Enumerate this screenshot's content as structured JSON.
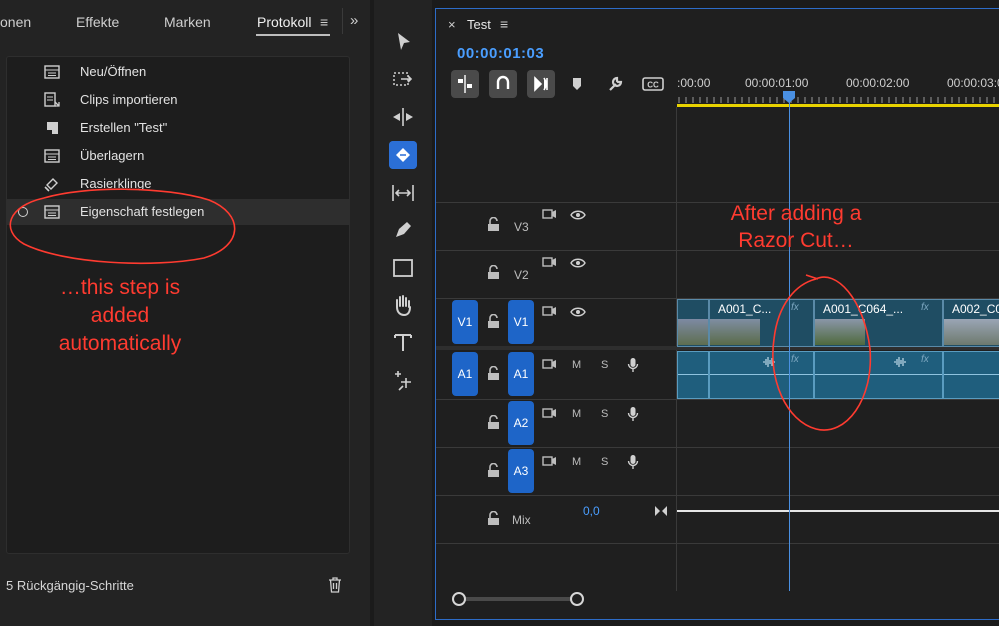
{
  "left_panel": {
    "tabs": [
      "onen",
      "Effekte",
      "Marken",
      "Protokoll"
    ],
    "active_tab": "Protokoll",
    "menu_icon": "hamburger-icon",
    "overflow_icon": "double-chevron-right-icon",
    "history": [
      {
        "label": "Neu/Öffnen",
        "icon": "sequence-icon"
      },
      {
        "label": "Clips importieren",
        "icon": "import-icon"
      },
      {
        "label": "Erstellen \"Test\"",
        "icon": "create-icon"
      },
      {
        "label": "Überlagern",
        "icon": "sequence-icon"
      },
      {
        "label": "Rasierklinge",
        "icon": "razor-icon"
      },
      {
        "label": "Eigenschaft festlegen",
        "icon": "sequence-icon",
        "selected": true
      }
    ],
    "footer": "5 Rückgängig-Schritte",
    "trash_icon": "trash-icon"
  },
  "annotations": {
    "left_lines": [
      "…this step is",
      "added",
      "automatically"
    ],
    "right_lines": [
      "After adding a",
      "Razor Cut…"
    ],
    "color": "#ff3b30"
  },
  "toolbar": {
    "tools": [
      "selection-tool-icon",
      "track-select-forward-icon",
      "ripple-edit-icon",
      "razor-tool-icon",
      "slip-tool-icon",
      "pen-tool-icon",
      "rectangle-tool-icon",
      "hand-tool-icon",
      "type-tool-icon",
      "remix-tool-icon"
    ],
    "active_tool": "razor-tool-icon",
    "active_color": "#2b6fd6"
  },
  "timeline": {
    "tab_title": "Test",
    "timecode": "00:00:01:03",
    "ruler_labels": [
      ":00:00",
      "00:00:01:00",
      "00:00:02:00",
      "00:00:03:0"
    ],
    "tracks": [
      {
        "target": "",
        "name": "V3"
      },
      {
        "target": "",
        "name": "V2"
      },
      {
        "target": "V1",
        "name": "V1"
      },
      {
        "target": "A1",
        "name": "A1",
        "m": "M",
        "s": "S"
      },
      {
        "target": "",
        "name": "A2",
        "m": "M",
        "s": "S"
      },
      {
        "target": "",
        "name": "A3",
        "m": "M",
        "s": "S"
      }
    ],
    "mix": {
      "label": "Mix",
      "value": "0,0"
    },
    "clips": [
      {
        "label": "A001_C..."
      },
      {
        "label": "A001_C064_..."
      },
      {
        "label": "A002_C0"
      }
    ],
    "fx_label": "fx",
    "playhead_color": "#4a90e2",
    "work_area_color": "#e8d200"
  }
}
